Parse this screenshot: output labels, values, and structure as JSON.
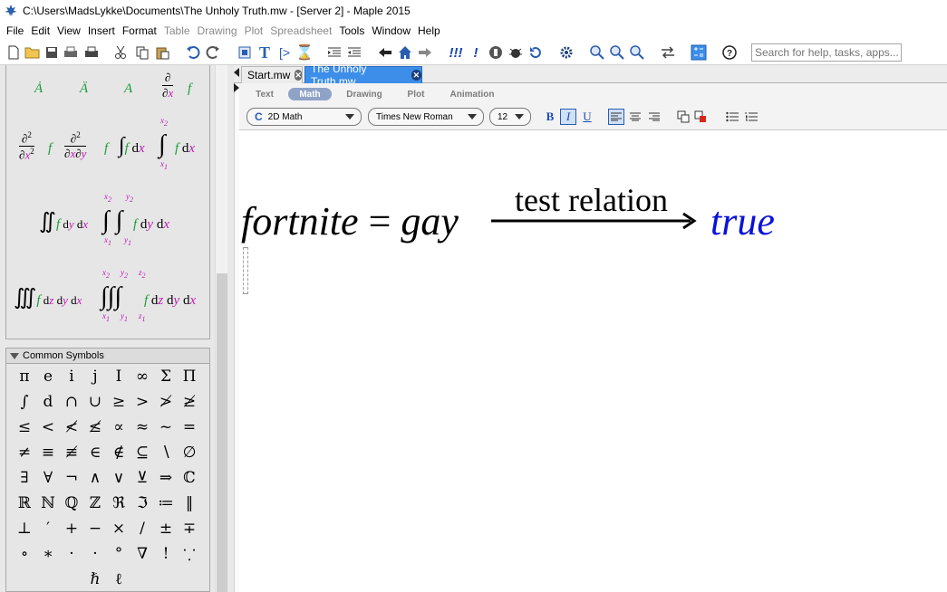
{
  "window": {
    "title": "C:\\Users\\MadsLykke\\Documents\\The Unholy Truth.mw - [Server 2] - Maple 2015"
  },
  "menu": {
    "items": [
      {
        "label": "File",
        "enabled": true
      },
      {
        "label": "Edit",
        "enabled": true
      },
      {
        "label": "View",
        "enabled": true
      },
      {
        "label": "Insert",
        "enabled": true
      },
      {
        "label": "Format",
        "enabled": true
      },
      {
        "label": "Table",
        "enabled": false
      },
      {
        "label": "Drawing",
        "enabled": false
      },
      {
        "label": "Plot",
        "enabled": false
      },
      {
        "label": "Spreadsheet",
        "enabled": false
      },
      {
        "label": "Tools",
        "enabled": true
      },
      {
        "label": "Window",
        "enabled": true
      },
      {
        "label": "Help",
        "enabled": true
      }
    ]
  },
  "search": {
    "placeholder": "Search for help, tasks, apps..."
  },
  "tabs": [
    {
      "label": "Start.mw",
      "active": false
    },
    {
      "label": "The Unholy Truth.mw",
      "active": true
    }
  ],
  "context_bar": {
    "modes": [
      "Text",
      "Math",
      "Drawing",
      "Plot",
      "Animation"
    ],
    "active_mode": "Math",
    "style_select": "2D Math",
    "font_select": "Times New Roman",
    "size_select": "12",
    "format_buttons": [
      "B",
      "I",
      "U"
    ]
  },
  "palettes": {
    "calculus": {
      "derivative_d": "∂",
      "var_x": "x",
      "var_y": "y",
      "var_z": "z",
      "func_f": "f",
      "var_A": "A",
      "sup_2": "2",
      "sub_1": "1",
      "d_x": "dx",
      "d_y": "dy",
      "d_z": "dz"
    },
    "common_symbols": {
      "title": "Common Symbols",
      "symbols": [
        [
          "π",
          "e",
          "i",
          "j",
          "I",
          "∞",
          "Σ",
          "Π"
        ],
        [
          "∫",
          "d",
          "∩",
          "∪",
          "≥",
          ">",
          "≯",
          "≱"
        ],
        [
          "≤",
          "<",
          "≮",
          "≰",
          "∝",
          "≈",
          "~",
          "="
        ],
        [
          "≠",
          "≡",
          "≢",
          "∈",
          "∉",
          "⊆",
          "∖",
          "∅"
        ],
        [
          "∃",
          "∀",
          "¬",
          "∧",
          "∨",
          "⊻",
          "⇒",
          "ℂ"
        ],
        [
          "ℝ",
          "ℕ",
          "ℚ",
          "ℤ",
          "ℜ",
          "ℑ",
          "≔",
          "‖"
        ],
        [
          "⊥",
          "′",
          "+",
          "−",
          "×",
          "/",
          "±",
          "∓"
        ],
        [
          "∘",
          "∗",
          "·",
          "·",
          "°",
          "∇",
          "!",
          "⸪"
        ],
        [
          "",
          "",
          "",
          "ℏ",
          "ℓ",
          "",
          "",
          ""
        ]
      ]
    }
  },
  "worksheet": {
    "lhs": "fortnite",
    "equals": "=",
    "rhs": "gay",
    "arrow_label": "test relation",
    "result": "true"
  },
  "colors": {
    "result_blue": "#0a12d8",
    "palette_green": "#1a9c3a",
    "palette_magenta": "#c11cb5",
    "active_tab": "#3c8ee8",
    "mode_active": "#8ea3c6"
  }
}
